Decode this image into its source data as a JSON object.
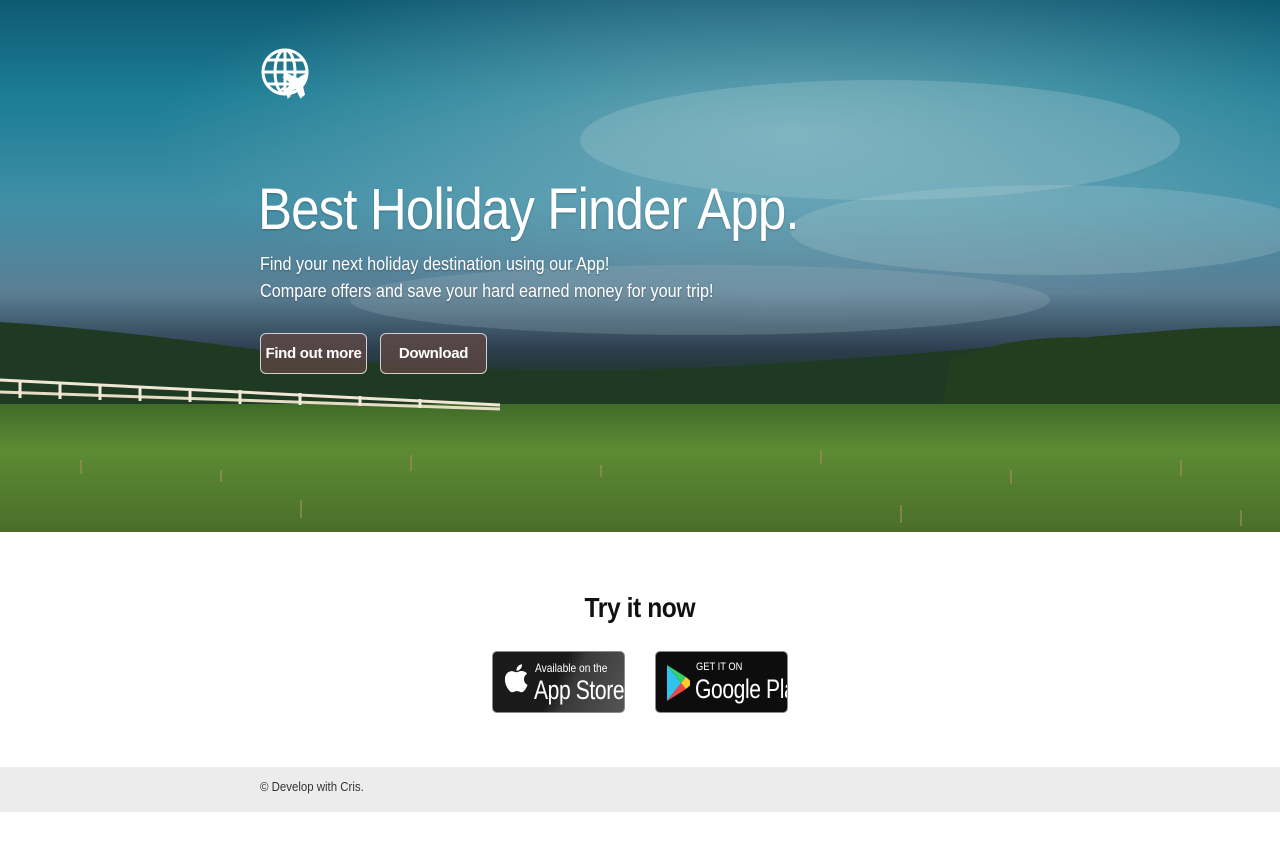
{
  "hero": {
    "logo_icon": "globe-airplane-icon",
    "title": "Best Holiday Finder App.",
    "subtitle_line1": "Find your next holiday destination using our App!",
    "subtitle_line2": "Compare offers and save your hard earned money for your trip!",
    "buttons": {
      "find_more": "Find out more",
      "download": "Download"
    }
  },
  "try_section": {
    "title": "Try it now",
    "app_store": {
      "icon": "apple-icon",
      "small_text": "Available on the",
      "big_text": "App Store"
    },
    "google_play": {
      "icon": "google-play-icon",
      "small_text": "GET IT ON",
      "big_text": "Google Play"
    }
  },
  "footer": {
    "text": "© Develop with Cris."
  },
  "colors": {
    "hero_sky": "#1b7d94",
    "button_bg": "#5f4644",
    "footer_bg": "#ececec",
    "grass": "#4f7a2c"
  }
}
